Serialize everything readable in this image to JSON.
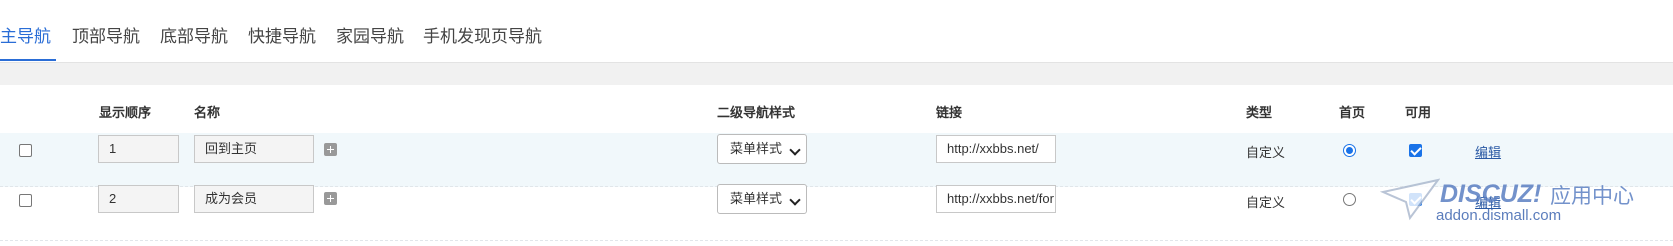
{
  "tabs": [
    {
      "label": "主导航",
      "active": true
    },
    {
      "label": "顶部导航",
      "active": false
    },
    {
      "label": "底部导航",
      "active": false
    },
    {
      "label": "快捷导航",
      "active": false
    },
    {
      "label": "家园导航",
      "active": false
    },
    {
      "label": "手机发现页导航",
      "active": false
    }
  ],
  "table": {
    "headers": {
      "order": "显示顺序",
      "name": "名称",
      "substyle": "二级导航样式",
      "link": "链接",
      "type": "类型",
      "home": "首页",
      "enabled": "可用"
    },
    "rows": [
      {
        "checked": false,
        "order": "1",
        "name": "回到主页",
        "substyle": "菜单样式",
        "link": "http://xxbbs.net/",
        "type": "自定义",
        "home": true,
        "enabled": true,
        "edit": "编辑"
      },
      {
        "checked": false,
        "order": "2",
        "name": "成为会员",
        "substyle": "菜单样式",
        "link": "http://xxbbs.net/for",
        "type": "自定义",
        "home": false,
        "enabled": true,
        "edit": "编辑"
      }
    ]
  },
  "watermark": {
    "brand": "DISCUZ!",
    "brand_cn": "应用中心",
    "url": "addon.dismall.com"
  },
  "colors": {
    "accent": "#2a6dd6",
    "row_highlight": "#f1f8fb",
    "link": "#2b5aa5",
    "control_checked": "#1a73e8"
  }
}
